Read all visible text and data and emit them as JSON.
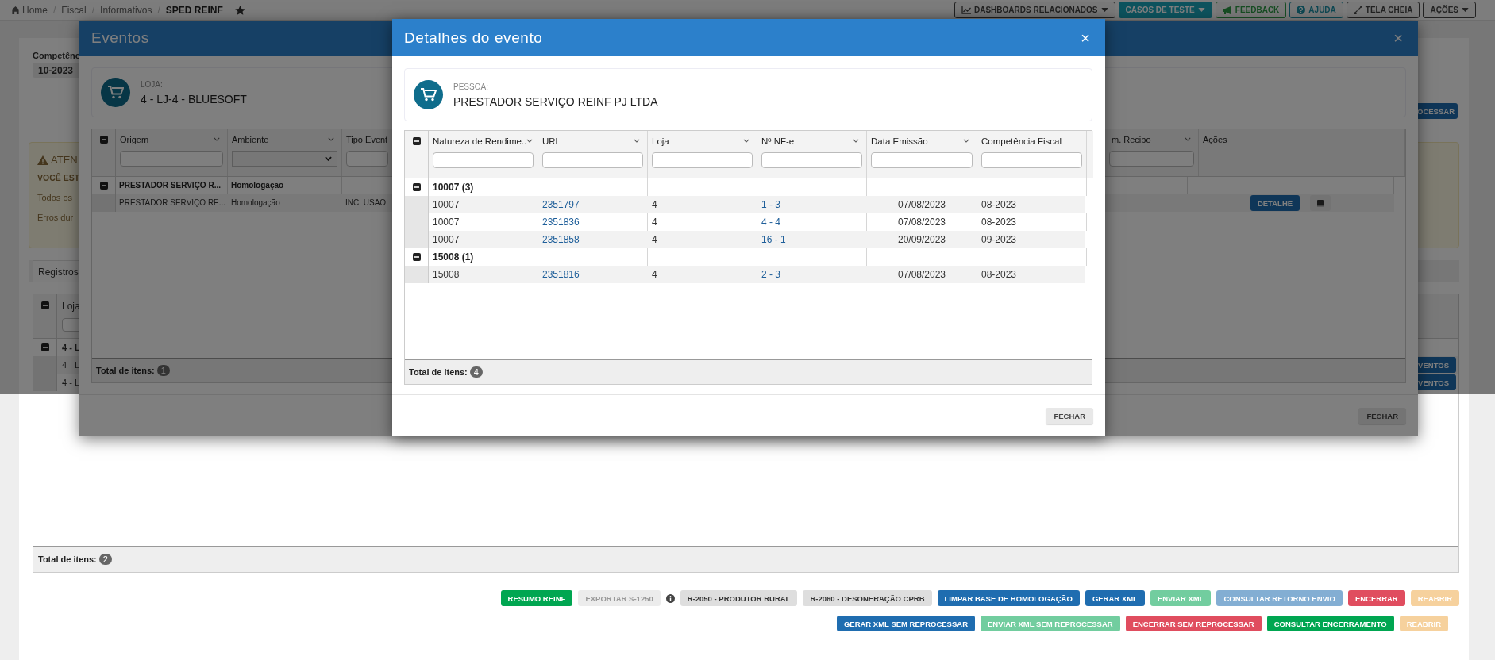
{
  "topbar": {
    "separator": "/",
    "breadcrumb": [
      {
        "label": "Home",
        "current": false
      },
      {
        "label": "Fiscal",
        "current": false
      },
      {
        "label": "Informativos",
        "current": false
      },
      {
        "label": "SPED REINF",
        "current": true
      }
    ],
    "favorite": true,
    "buttons": [
      {
        "label": "DASHBOARDS RELACIONADOS",
        "kind": "dashboards"
      },
      {
        "label": "CASOS DE TESTE",
        "kind": "tests"
      },
      {
        "label": "FEEDBACK",
        "kind": "feedback"
      },
      {
        "label": "AJUDA",
        "kind": "help"
      },
      {
        "label": "TELA CHEIA",
        "kind": "fullscreen"
      },
      {
        "label": "AÇÕES",
        "kind": "actions"
      }
    ]
  },
  "page": {
    "competencia": {
      "label": "Competênc",
      "value": "10-2023"
    },
    "process_button": "OCESSAR",
    "alert": {
      "title": "ATEN",
      "lines": [
        "VOCÊ EST",
        "Todos os",
        "Erros dur"
      ]
    },
    "tabs": [
      {
        "label": "Registros",
        "selected": true
      }
    ],
    "grid": {
      "columns": [
        "Loja"
      ],
      "rows": [
        {
          "kind": "group",
          "text": "4 - L",
          "expanded": true
        },
        {
          "kind": "row",
          "text": "4 - L",
          "action": "VENTOS"
        },
        {
          "kind": "row",
          "text": "4 - L",
          "action": "VENTOS"
        }
      ],
      "total_label": "Total de itens:",
      "total": "2"
    },
    "buttons_row_1": [
      {
        "label": "RESUMO REINF",
        "kind": "success",
        "disabled": false
      },
      {
        "label": "EXPORTAR S-1250",
        "kind": "default",
        "disabled": true,
        "info": true
      },
      {
        "label": "R-2050 - PRODUTOR RURAL",
        "kind": "default",
        "disabled": false
      },
      {
        "label": "R-2060 - DESONERAÇÃO CPRB",
        "kind": "default",
        "disabled": false
      },
      {
        "label": "LIMPAR BASE DE HOMOLOGAÇÃO",
        "kind": "primary",
        "disabled": false
      },
      {
        "label": "GERAR XML",
        "kind": "primary",
        "disabled": false
      },
      {
        "label": "ENVIAR XML",
        "kind": "success",
        "disabled": true
      },
      {
        "label": "CONSULTAR RETORNO ENVIO",
        "kind": "primary",
        "disabled": true
      },
      {
        "label": "ENCERRAR",
        "kind": "danger",
        "disabled": false
      },
      {
        "label": "REABRIR",
        "kind": "warning",
        "disabled": true
      }
    ],
    "buttons_row_2": [
      {
        "label": "GERAR XML SEM REPROCESSAR",
        "kind": "primary",
        "disabled": false
      },
      {
        "label": "ENVIAR XML SEM REPROCESSAR",
        "kind": "success",
        "disabled": true
      },
      {
        "label": "ENCERRAR SEM REPROCESSAR",
        "kind": "danger",
        "disabled": false
      },
      {
        "label": "CONSULTAR ENCERRAMENTO",
        "kind": "success",
        "disabled": false
      },
      {
        "label": "REABRIR",
        "kind": "warning",
        "disabled": true
      }
    ]
  },
  "events_modal": {
    "title": "Eventos",
    "close": "×",
    "card": {
      "label": "LOJA:",
      "value": "4 - LJ-4 - BLUESOFT"
    },
    "columns": [
      {
        "label": "Origem",
        "kind": "text-filter",
        "menu": true
      },
      {
        "label": "Ambiente",
        "kind": "select-filter",
        "menu": true
      },
      {
        "label": "Tipo Event",
        "kind": "text-filter",
        "menu": false
      },
      {
        "label": "m. Recibo",
        "kind": "text-filter",
        "menu": true
      },
      {
        "label": "Ações",
        "kind": "actions",
        "menu": false
      }
    ],
    "rows": [
      {
        "kind": "group",
        "expanded": true,
        "cells": [
          "PRESTADOR SERVIÇO R...",
          "Homologação"
        ]
      },
      {
        "kind": "row",
        "cells": [
          "PRESTADOR SERVIÇO RE...",
          "Homologação",
          "INCLUSAO"
        ],
        "action": "DETALHE"
      }
    ],
    "total_label": "Total de itens:",
    "total": "1",
    "footer_button": "FECHAR"
  },
  "detail_modal": {
    "title": "Detalhes do evento",
    "close": "×",
    "card": {
      "label": "PESSOA:",
      "value": "PRESTADOR SERVIÇO REINF PJ LTDA"
    },
    "columns": [
      {
        "label": "Natureza de Rendime..",
        "kind": "text",
        "menu": true
      },
      {
        "label": "URL",
        "kind": "link",
        "menu": true
      },
      {
        "label": "Loja",
        "kind": "text",
        "menu": true
      },
      {
        "label": "Nº NF-e",
        "kind": "link",
        "menu": true
      },
      {
        "label": "Data Emissão",
        "kind": "date",
        "menu": true
      },
      {
        "label": "Competência Fiscal",
        "kind": "text",
        "menu": false
      }
    ],
    "rows": [
      {
        "kind": "group",
        "expanded": true,
        "label": "10007 (3)"
      },
      {
        "kind": "row",
        "cells": [
          "10007",
          "2351797",
          "4",
          "1 - 3",
          "07/08/2023",
          "08-2023"
        ]
      },
      {
        "kind": "row",
        "cells": [
          "10007",
          "2351836",
          "4",
          "4 - 4",
          "07/08/2023",
          "08-2023"
        ]
      },
      {
        "kind": "row",
        "cells": [
          "10007",
          "2351858",
          "4",
          "16 - 1",
          "20/09/2023",
          "09-2023"
        ]
      },
      {
        "kind": "group",
        "expanded": true,
        "label": "15008 (1)"
      },
      {
        "kind": "row",
        "cells": [
          "15008",
          "2351816",
          "4",
          "2 - 3",
          "07/08/2023",
          "08-2023"
        ]
      }
    ],
    "total_label": "Total de itens:",
    "total": "4",
    "footer_button": "FECHAR"
  }
}
